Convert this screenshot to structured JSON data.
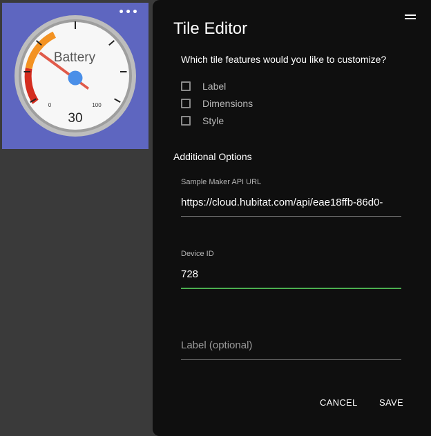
{
  "tile": {
    "gauge_label": "Battery",
    "gauge_value": "30",
    "gauge_min": "0",
    "gauge_max": "100",
    "menu_icon": "ellipsis-icon"
  },
  "editor": {
    "title": "Tile Editor",
    "menu_icon": "hamburger-icon",
    "question": "Which tile features would you like to customize?",
    "checkboxes": [
      {
        "label": "Label",
        "checked": false
      },
      {
        "label": "Dimensions",
        "checked": false
      },
      {
        "label": "Style",
        "checked": false
      }
    ],
    "additional_options": "Additional Options",
    "api_url": {
      "label": "Sample Maker API URL",
      "value": "https://cloud.hubitat.com/api/eae18ffb-86d0-"
    },
    "device_id": {
      "label": "Device ID",
      "value": "728"
    },
    "label_field": {
      "placeholder": "Label (optional)",
      "value": ""
    },
    "cancel": "CANCEL",
    "save": "SAVE"
  },
  "colors": {
    "tile_bg": "#5e66c0",
    "panel_bg": "#0f0f0f",
    "active_underline": "#4caf50"
  }
}
